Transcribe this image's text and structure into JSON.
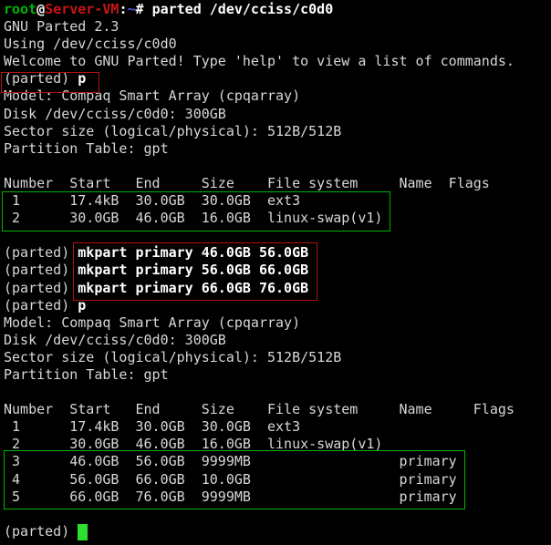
{
  "terminal": {
    "colors": {
      "background": "#000000",
      "foreground": "#d7d7d7",
      "bold_foreground": "#ffffff",
      "user_green": "#00b400",
      "host_red": "#cc1414",
      "path_blue": "#5454e8",
      "annotation_red": "#b31212",
      "annotation_green": "#00b400",
      "cursor_green": "#2fdf2f"
    },
    "prompt": {
      "user": "root",
      "host": "Server-VM",
      "path": "~",
      "parted_prompt": "(parted) "
    },
    "commands": [
      "parted /dev/cciss/c0d0",
      "p",
      "mkpart primary 46.0GB 56.0GB",
      "mkpart primary 56.0GB 66.0GB",
      "mkpart primary 66.0GB 76.0GB",
      "p"
    ],
    "disk_info": {
      "parted_version": "GNU Parted 2.3",
      "device": "/dev/cciss/c0d0",
      "model": "Compaq Smart Array (cpqarray)",
      "disk_size": "300GB",
      "sector_size": "512B/512B",
      "partition_table": "gpt"
    },
    "tables": [
      {
        "headers": [
          "Number",
          "Start",
          "End",
          "Size",
          "File system",
          "Name",
          "Flags"
        ],
        "rows": [
          [
            "1",
            "17.4kB",
            "30.0GB",
            "30.0GB",
            "ext3",
            "",
            ""
          ],
          [
            "2",
            "30.0GB",
            "46.0GB",
            "16.0GB",
            "linux-swap(v1)",
            "",
            ""
          ]
        ]
      },
      {
        "headers": [
          "Number",
          "Start",
          "End",
          "Size",
          "File system",
          "Name",
          "Flags"
        ],
        "rows": [
          [
            "1",
            "17.4kB",
            "30.0GB",
            "30.0GB",
            "ext3",
            "",
            ""
          ],
          [
            "2",
            "30.0GB",
            "46.0GB",
            "16.0GB",
            "linux-swap(v1)",
            "",
            ""
          ],
          [
            "3",
            "46.0GB",
            "56.0GB",
            "9999MB",
            "",
            "primary",
            ""
          ],
          [
            "4",
            "56.0GB",
            "66.0GB",
            "10.0GB",
            "",
            "primary",
            ""
          ],
          [
            "5",
            "66.0GB",
            "76.0GB",
            "9999MB",
            "",
            "primary",
            ""
          ]
        ]
      }
    ],
    "lines": [
      {
        "segments": [
          {
            "text": "root",
            "style": "user"
          },
          {
            "text": "@",
            "style": "punct"
          },
          {
            "text": "Server-VM",
            "style": "host"
          },
          {
            "text": ":",
            "style": "punct"
          },
          {
            "text": "~",
            "style": "path"
          },
          {
            "text": "# ",
            "style": "punct"
          },
          {
            "text": "parted /dev/cciss/c0d0",
            "style": "cmd"
          }
        ]
      },
      {
        "segments": [
          {
            "text": "GNU Parted 2.3",
            "style": "plain"
          }
        ]
      },
      {
        "segments": [
          {
            "text": "Using /dev/cciss/c0d0",
            "style": "plain"
          }
        ]
      },
      {
        "segments": [
          {
            "text": "Welcome to GNU Parted! Type 'help' to view a list of commands.",
            "style": "plain"
          }
        ]
      },
      {
        "segments": [
          {
            "text": "(parted) ",
            "style": "plain"
          },
          {
            "text": "p",
            "style": "cmd"
          }
        ]
      },
      {
        "segments": [
          {
            "text": "Model: Compaq Smart Array (cpqarray)",
            "style": "plain"
          }
        ]
      },
      {
        "segments": [
          {
            "text": "Disk /dev/cciss/c0d0: 300GB",
            "style": "plain"
          }
        ]
      },
      {
        "segments": [
          {
            "text": "Sector size (logical/physical): 512B/512B",
            "style": "plain"
          }
        ]
      },
      {
        "segments": [
          {
            "text": "Partition Table: gpt",
            "style": "plain"
          }
        ]
      },
      {
        "segments": []
      },
      {
        "segments": [
          {
            "text": "Number  Start   End     Size    File system     Name  Flags",
            "style": "plain"
          }
        ]
      },
      {
        "segments": [
          {
            "text": " 1      17.4kB  30.0GB  30.0GB  ext3",
            "style": "plain"
          }
        ]
      },
      {
        "segments": [
          {
            "text": " 2      30.0GB  46.0GB  16.0GB  linux-swap(v1)",
            "style": "plain"
          }
        ]
      },
      {
        "segments": []
      },
      {
        "segments": [
          {
            "text": "(parted) ",
            "style": "plain"
          },
          {
            "text": "mkpart primary 46.0GB 56.0GB",
            "style": "cmd"
          }
        ]
      },
      {
        "segments": [
          {
            "text": "(parted) ",
            "style": "plain"
          },
          {
            "text": "mkpart primary 56.0GB 66.0GB",
            "style": "cmd"
          }
        ]
      },
      {
        "segments": [
          {
            "text": "(parted) ",
            "style": "plain"
          },
          {
            "text": "mkpart primary 66.0GB 76.0GB",
            "style": "cmd"
          }
        ]
      },
      {
        "segments": [
          {
            "text": "(parted) ",
            "style": "plain"
          },
          {
            "text": "p",
            "style": "cmd"
          }
        ]
      },
      {
        "segments": [
          {
            "text": "Model: Compaq Smart Array (cpqarray)",
            "style": "plain"
          }
        ]
      },
      {
        "segments": [
          {
            "text": "Disk /dev/cciss/c0d0: 300GB",
            "style": "plain"
          }
        ]
      },
      {
        "segments": [
          {
            "text": "Sector size (logical/physical): 512B/512B",
            "style": "plain"
          }
        ]
      },
      {
        "segments": [
          {
            "text": "Partition Table: gpt",
            "style": "plain"
          }
        ]
      },
      {
        "segments": []
      },
      {
        "segments": [
          {
            "text": "Number  Start   End     Size    File system     Name     Flags",
            "style": "plain"
          }
        ]
      },
      {
        "segments": [
          {
            "text": " 1      17.4kB  30.0GB  30.0GB  ext3",
            "style": "plain"
          }
        ]
      },
      {
        "segments": [
          {
            "text": " 2      30.0GB  46.0GB  16.0GB  linux-swap(v1)",
            "style": "plain"
          }
        ]
      },
      {
        "segments": [
          {
            "text": " 3      46.0GB  56.0GB  9999MB                  primary",
            "style": "plain"
          }
        ]
      },
      {
        "segments": [
          {
            "text": " 4      56.0GB  66.0GB  10.0GB                  primary",
            "style": "plain"
          }
        ]
      },
      {
        "segments": [
          {
            "text": " 5      66.0GB  76.0GB  9999MB                  primary",
            "style": "plain"
          }
        ]
      },
      {
        "segments": []
      },
      {
        "segments": [
          {
            "text": "(parted) ",
            "style": "plain"
          }
        ]
      }
    ],
    "cursor_visible": true,
    "annotations": [
      {
        "id": "parted-p-command",
        "color": "red"
      },
      {
        "id": "initial-partitions",
        "color": "green"
      },
      {
        "id": "mkpart-commands",
        "color": "red"
      },
      {
        "id": "new-partitions",
        "color": "green"
      }
    ]
  }
}
